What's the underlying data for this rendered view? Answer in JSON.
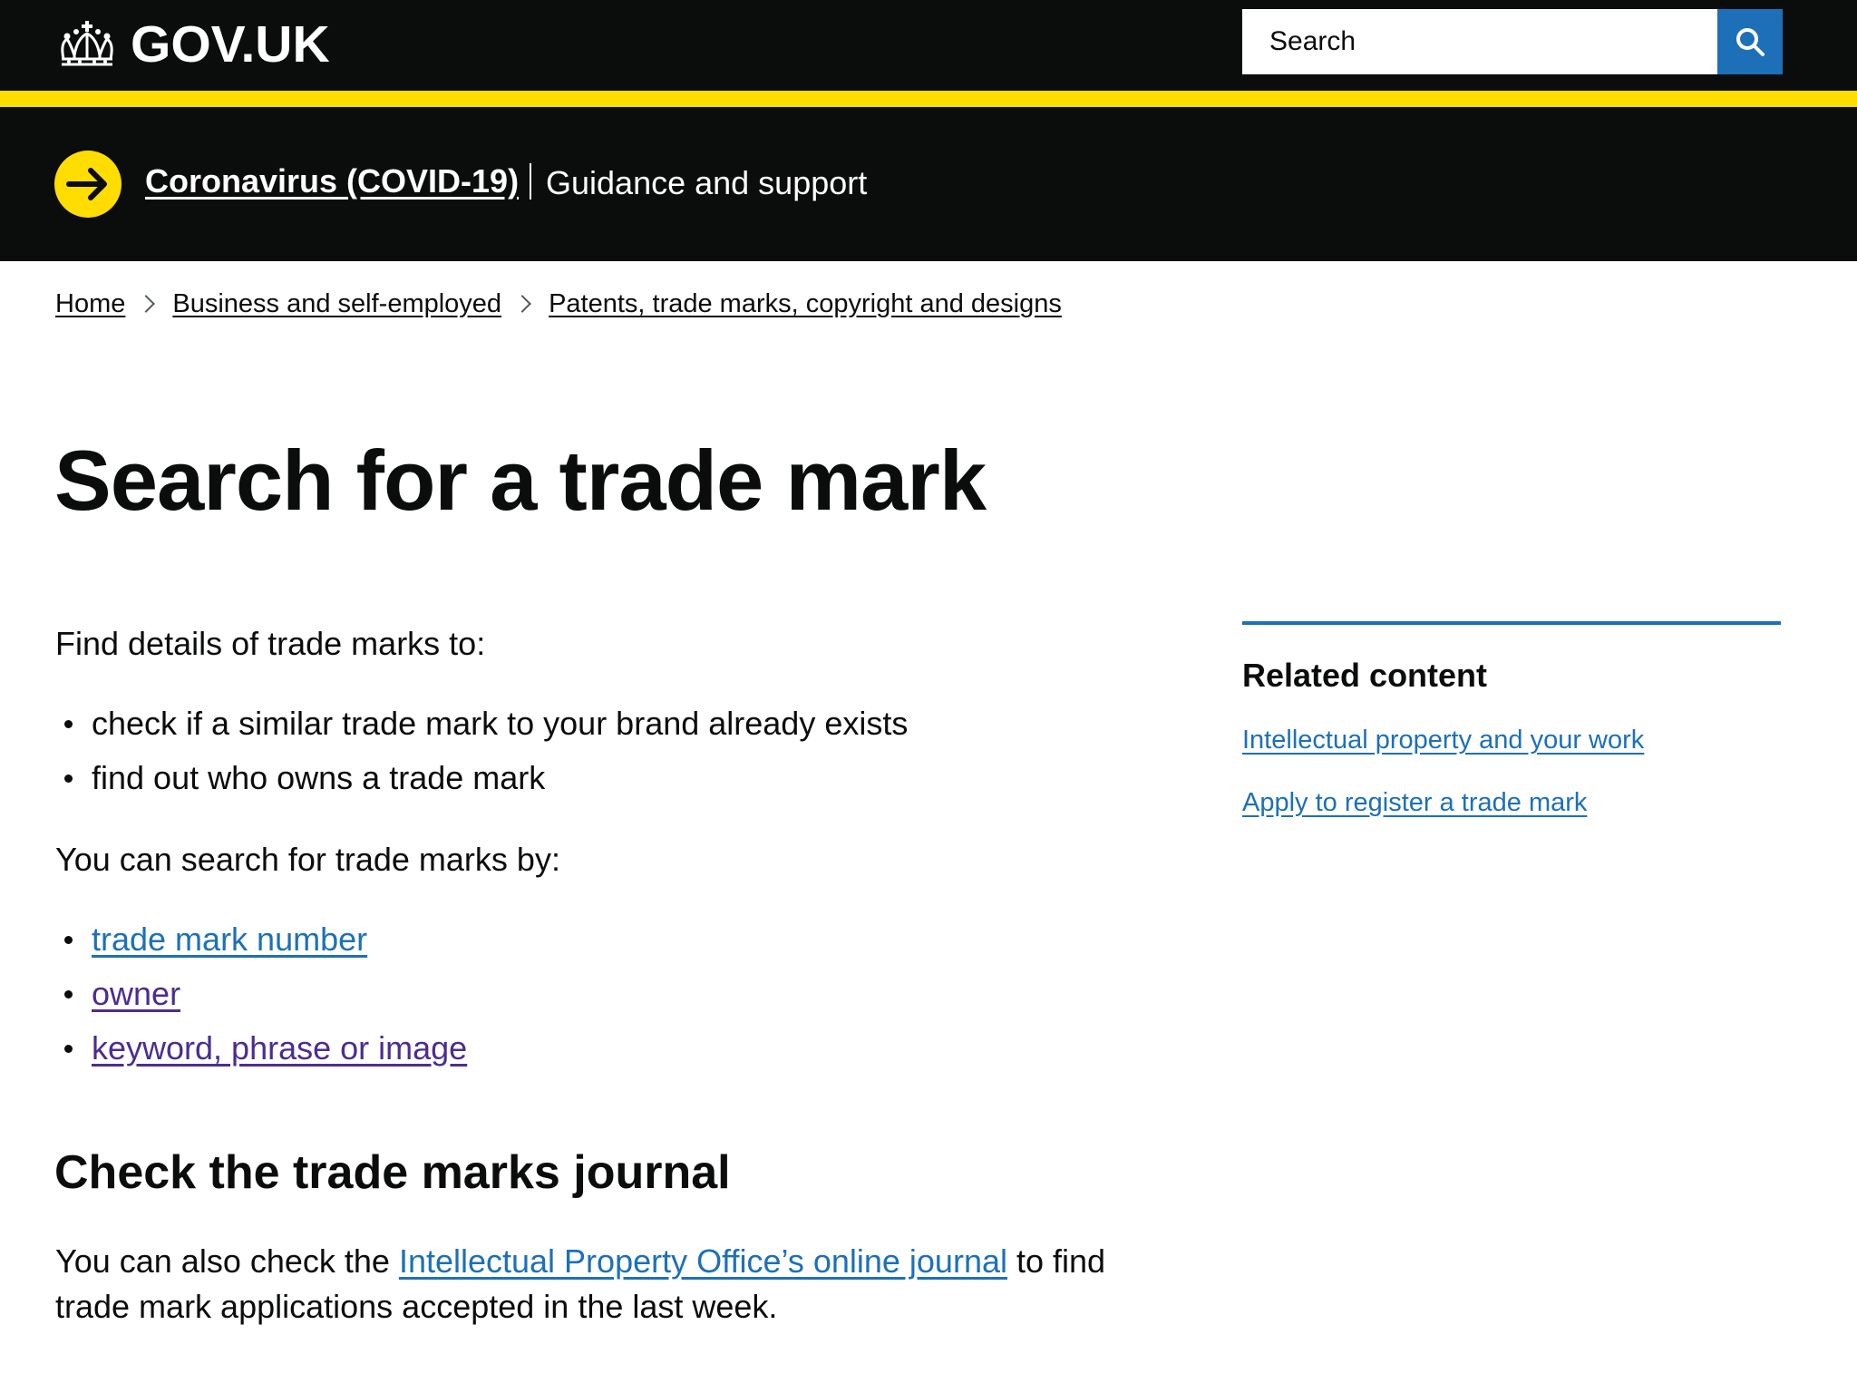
{
  "header": {
    "logo_text": "GOV.UK",
    "search": {
      "placeholder": "Search",
      "button_icon": "magnifier-icon"
    }
  },
  "covid_banner": {
    "link_text": "Coronavirus (COVID-19)",
    "subtitle": "Guidance and support",
    "icon": "arrow-circle-icon"
  },
  "breadcrumbs": [
    "Home",
    "Business and self-employed",
    "Patents, trade marks, copyright and designs"
  ],
  "main": {
    "title": "Search for a trade mark",
    "intro": "Find details of trade marks to:",
    "purposes": [
      "check if a similar trade mark to your brand already exists",
      "find out who owns a trade mark"
    ],
    "search_by_intro": "You can search for trade marks by:",
    "search_by_links": [
      "trade mark number",
      "owner",
      "keyword, phrase or image"
    ],
    "journal": {
      "heading": "Check the trade marks journal",
      "before_link": "You can also check the ",
      "link_text": "Intellectual Property Office’s online journal",
      "after_link": " to find trade mark applications accepted in the last week."
    }
  },
  "related": {
    "heading": "Related content",
    "links": [
      "Intellectual property and your work",
      "Apply to register a trade mark"
    ]
  },
  "colors": {
    "header_bg": "#0b0c0c",
    "yellow_bar": "#ffdd00",
    "link_blue": "#1d70b8",
    "link_visited": "#4c2c92",
    "search_button": "#1d70b8"
  }
}
